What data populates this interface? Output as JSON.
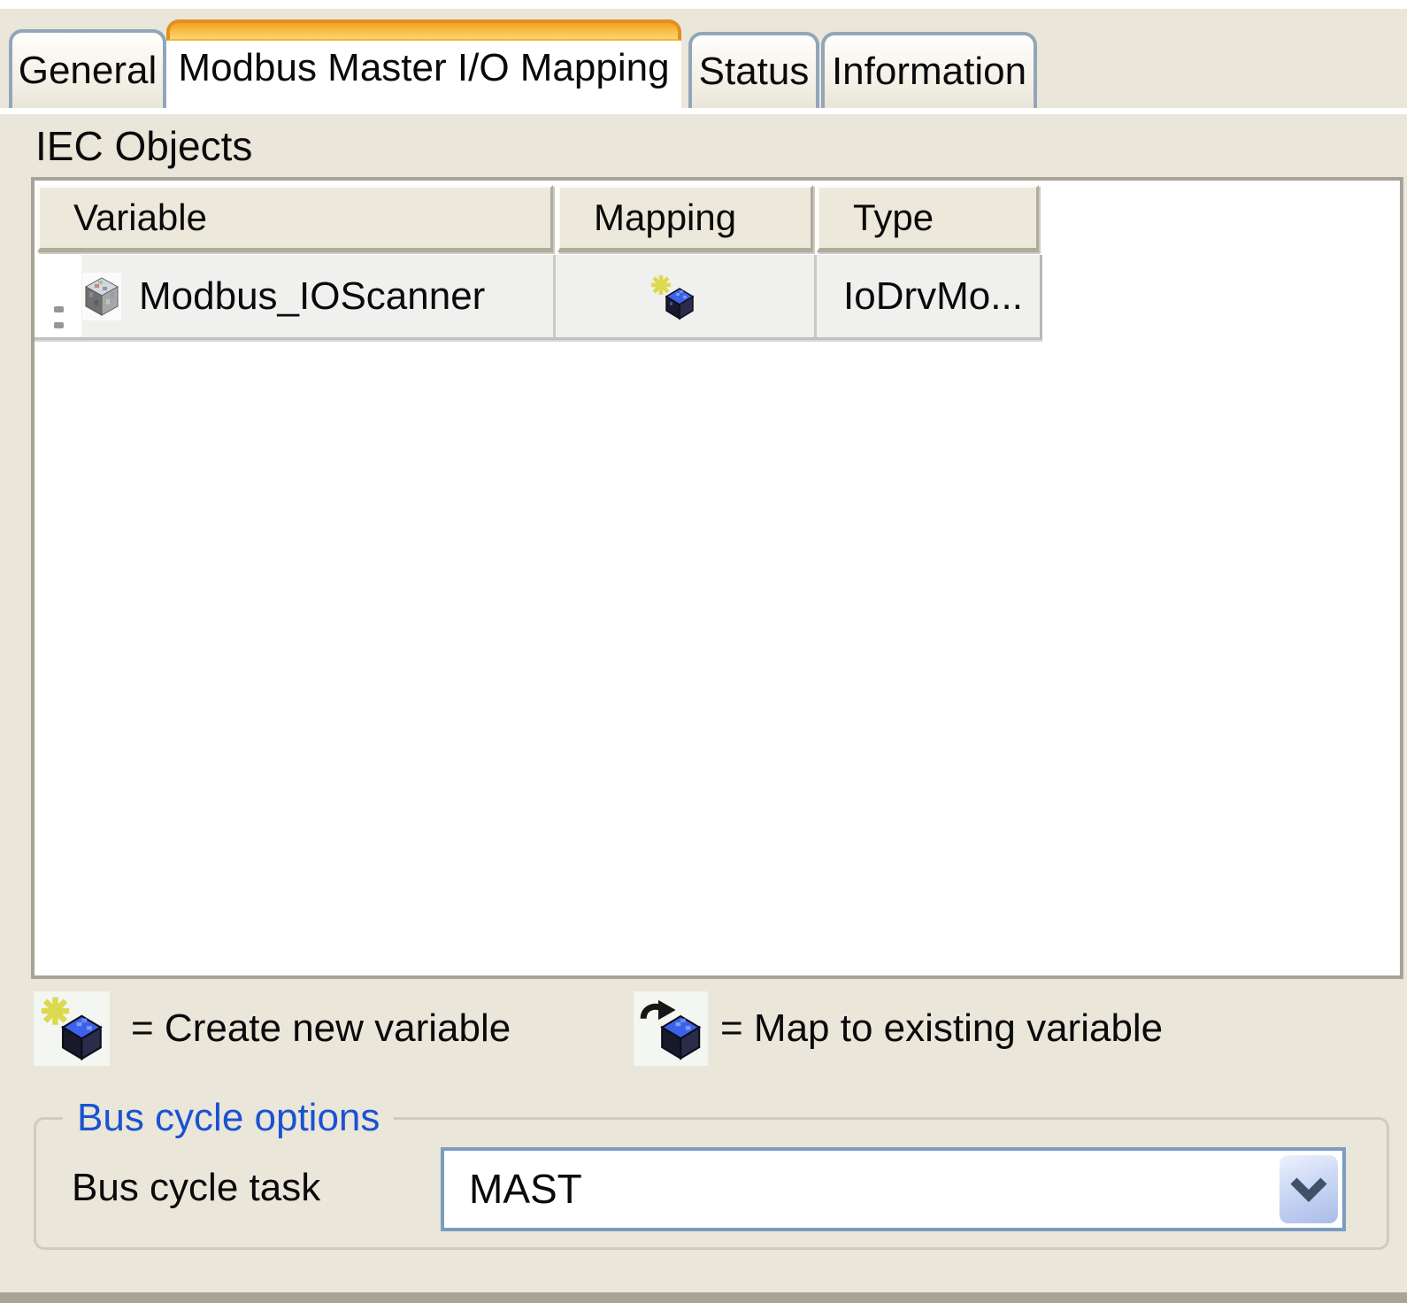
{
  "colors": {
    "panel_bg": "#eae6da",
    "active_tab_accent": "#e0901e",
    "inactive_tab_border": "#92a6b9",
    "table_border": "#a7a396",
    "row_bg": "#f0f0ef",
    "group_title_blue": "#1b52d2",
    "dropdown_border": "#7b9dbf",
    "chevron_color": "#3e5267"
  },
  "tabs": {
    "items": [
      {
        "label": "General",
        "active": false
      },
      {
        "label": "Modbus Master I/O Mapping",
        "active": true
      },
      {
        "label": "Status",
        "active": false
      },
      {
        "label": "Information",
        "active": false
      }
    ]
  },
  "iec_objects": {
    "title": "IEC Objects",
    "columns": [
      "Variable",
      "Mapping",
      "Type"
    ],
    "rows": [
      {
        "variable": "Modbus_IOScanner",
        "variable_icon": "device-cube-icon",
        "mapping_icon": "create-new-variable-icon",
        "type": "IoDrvMo..."
      }
    ]
  },
  "legend": {
    "create_new": {
      "icon": "create-new-variable-icon",
      "label": "= Create new variable"
    },
    "map_existing": {
      "icon": "map-existing-variable-icon",
      "label": "= Map to existing variable"
    }
  },
  "bus_cycle": {
    "group_title": "Bus cycle options",
    "task_label": "Bus cycle task",
    "task_value": "MAST",
    "dropdown_icon": "chevron-down-icon"
  }
}
